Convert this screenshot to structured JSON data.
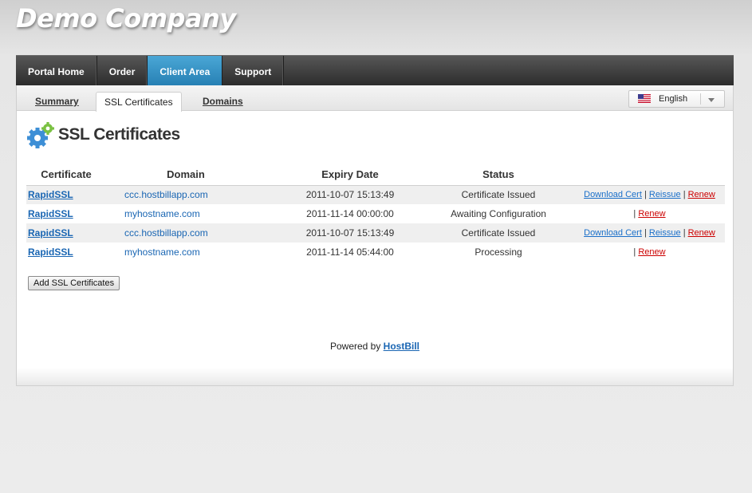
{
  "brand": "Demo Company",
  "nav": [
    {
      "label": "Portal Home"
    },
    {
      "label": "Order"
    },
    {
      "label": "Client Area",
      "active": true
    },
    {
      "label": "Support"
    }
  ],
  "subnav": {
    "summary": "Summary",
    "ssl": "SSL Certificates",
    "domains": "Domains"
  },
  "language": {
    "selected": "English",
    "icon": "us-flag-icon"
  },
  "page": {
    "title": "SSL Certificates",
    "icon": "gears-icon"
  },
  "table": {
    "headers": [
      "Certificate",
      "Domain",
      "Expiry Date",
      "Status"
    ],
    "rows": [
      {
        "cert": "RapidSSL",
        "domain": "ccc.hostbillapp.com",
        "expiry": "2011-10-07 15:13:49",
        "status": "Certificate Issued",
        "download": "Download Cert",
        "sep1": "|",
        "reissue": "Reissue",
        "sep2": "|",
        "renew": "Renew"
      },
      {
        "cert": "RapidSSL",
        "domain": "myhostname.com",
        "expiry": "2011-11-14 00:00:00",
        "status": "Awaiting Configuration",
        "sep2": "|",
        "renew": "Renew"
      },
      {
        "cert": "RapidSSL",
        "domain": "ccc.hostbillapp.com",
        "expiry": "2011-10-07 15:13:49",
        "status": "Certificate Issued",
        "download": "Download Cert",
        "sep1": "|",
        "reissue": "Reissue",
        "sep2": "|",
        "renew": "Renew"
      },
      {
        "cert": "RapidSSL",
        "domain": "myhostname.com",
        "expiry": "2011-11-14 05:44:00",
        "status": "Processing",
        "sep2": "|",
        "renew": "Renew"
      }
    ]
  },
  "add_button": "Add SSL Certificates",
  "footer": {
    "prefix": "Powered by ",
    "link": "HostBill"
  },
  "colors": {
    "nav_active": "#3594c8",
    "link": "#1a66b3",
    "renew": "#cc0000"
  }
}
